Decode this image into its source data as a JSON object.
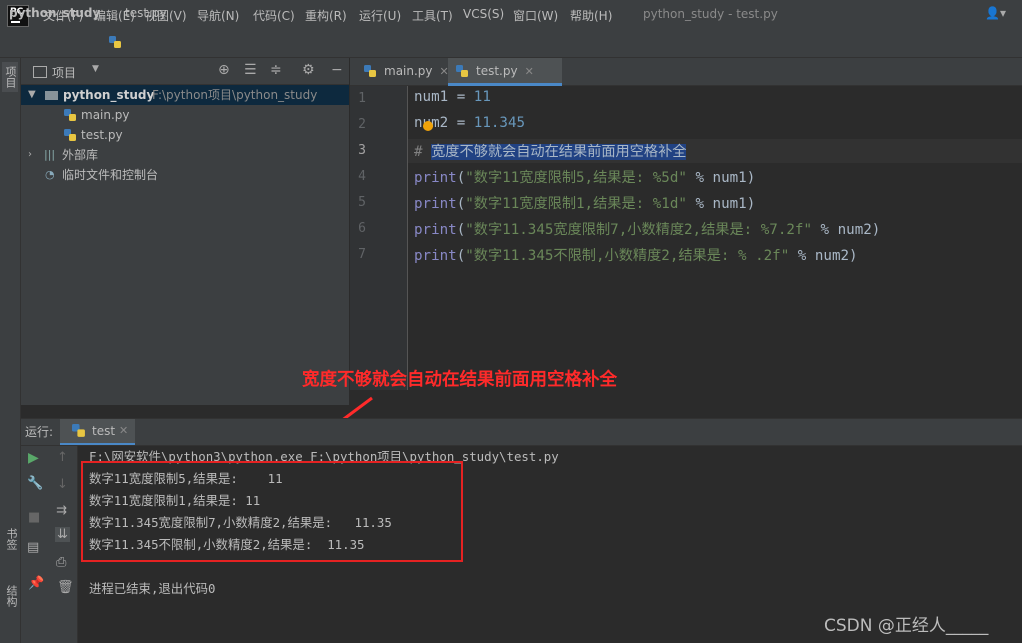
{
  "app": {
    "logo_text": "PC",
    "window_title": "python_study - test.py",
    "menu": [
      "文件(F)",
      "编辑(E)",
      "视图(V)",
      "导航(N)",
      "代码(C)",
      "重构(R)",
      "运行(U)",
      "工具(T)",
      "VCS(S)",
      "窗口(W)",
      "帮助(H)"
    ]
  },
  "breadcrumb": {
    "project": "python_study",
    "file": "test.py"
  },
  "sidebar_strip": {
    "project": "项目",
    "bookmarks": "书签",
    "structure": "结构"
  },
  "project_panel": {
    "title": "项目",
    "tree": {
      "root_name": "python_study",
      "root_path": "F:\\python项目\\python_study",
      "files": [
        "main.py",
        "test.py"
      ],
      "external_libs": "外部库",
      "scratches": "临时文件和控制台"
    }
  },
  "editor": {
    "tabs": [
      {
        "label": "main.py",
        "active": false
      },
      {
        "label": "test.py",
        "active": true
      }
    ],
    "line_numbers": [
      "1",
      "2",
      "3",
      "4",
      "5",
      "6",
      "7"
    ],
    "lines": {
      "l1": {
        "a": "num1",
        "b": " = ",
        "c": "11"
      },
      "l2": {
        "a": "num2",
        "b": " = ",
        "c": "11.345"
      },
      "l3": {
        "a": "# ",
        "b": "宽度不够就会自动在结果前面用空格补全"
      },
      "l4": {
        "fn": "print",
        "open": "(",
        "str": "\"数字11宽度限制5,结果是: %5d\"",
        "rest": " % num1)"
      },
      "l5": {
        "fn": "print",
        "open": "(",
        "str": "\"数字11宽度限制1,结果是: %1d\"",
        "rest": " % num1)"
      },
      "l6": {
        "fn": "print",
        "open": "(",
        "str": "\"数字11.345宽度限制7,小数精度2,结果是: %7.2f\"",
        "rest": " % num2)"
      },
      "l7": {
        "fn": "print",
        "open": "(",
        "str": "\"数字11.345不限制,小数精度2,结果是: % .2f\"",
        "rest": " % num2)"
      }
    }
  },
  "annotation": "宽度不够就会自动在结果前面用空格补全",
  "run_panel": {
    "label": "运行:",
    "tab": "test",
    "console": [
      "F:\\网安软件\\python3\\python.exe F:\\python项目\\python_study\\test.py",
      "数字11宽度限制5,结果是:    11",
      "数字11宽度限制1,结果是: 11",
      "数字11.345宽度限制7,小数精度2,结果是:   11.35",
      "数字11.345不限制,小数精度2,结果是:  11.35",
      "进程已结束,退出代码0"
    ]
  },
  "watermark": "CSDN @正经人_____",
  "colors": {
    "annotation": "#ff2a2a",
    "selection": "#214283",
    "tab_underline": "#4a88c7"
  }
}
